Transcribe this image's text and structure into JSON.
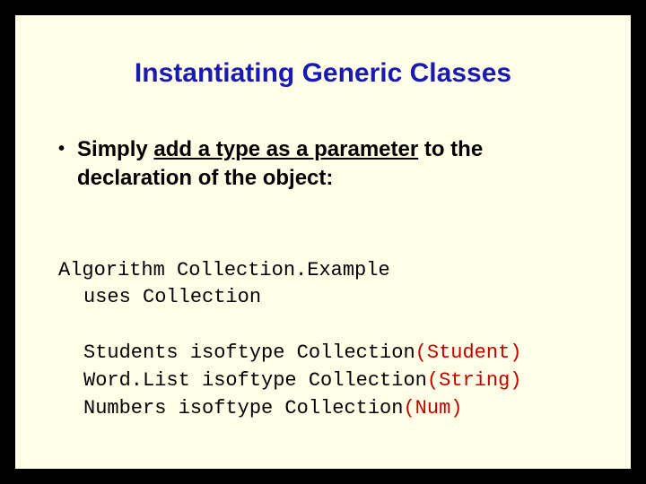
{
  "title": "Instantiating Generic Classes",
  "bullet": {
    "pre": "Simply ",
    "underlined": "add a type as a parameter",
    "post": " to the declaration of the object:"
  },
  "code": {
    "line1": "Algorithm Collection.Example",
    "line2": "uses Collection",
    "line3_pre": "Students isoftype Collection",
    "line3_param": "(Student)",
    "line4_pre": "Word.List isoftype Collection",
    "line4_param": "(String)",
    "line5_pre": "Numbers isoftype Collection",
    "line5_param": "(Num)"
  }
}
